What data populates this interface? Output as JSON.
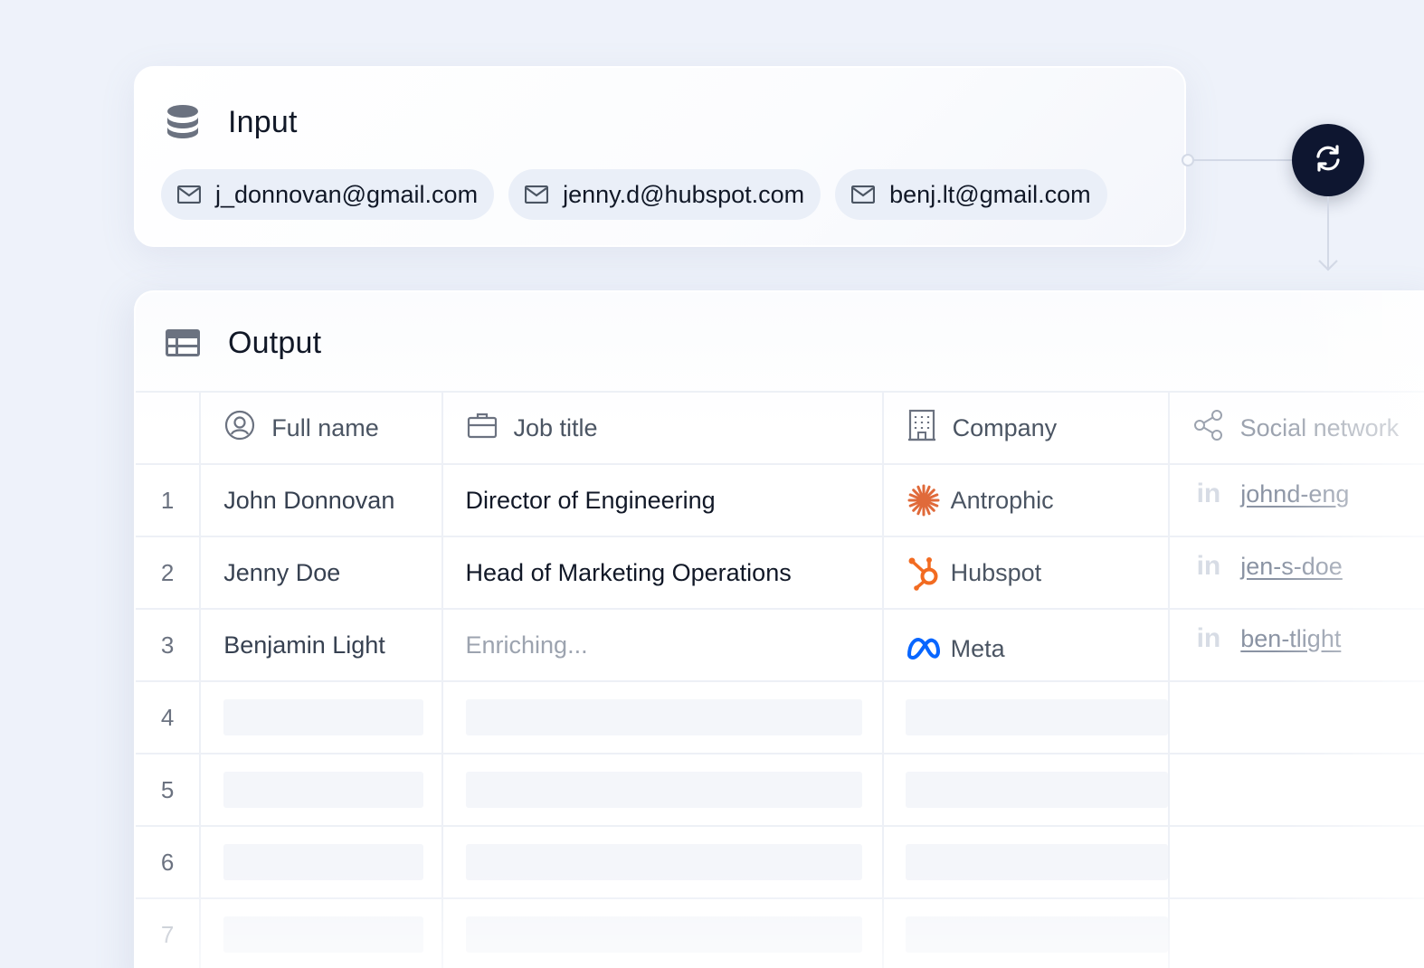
{
  "input": {
    "title": "Input",
    "header_icon": "database-icon",
    "emails": [
      {
        "icon": "mail-icon",
        "value": "j_donnovan@gmail.com"
      },
      {
        "icon": "mail-icon",
        "value": "jenny.d@hubspot.com"
      },
      {
        "icon": "mail-icon",
        "value": "benj.lt@gmail.com"
      }
    ]
  },
  "sync_button": {
    "icon": "sync-icon"
  },
  "output": {
    "title": "Output",
    "header_icon": "table-icon",
    "columns": [
      {
        "label": "Full name",
        "icon": "user-circle-icon"
      },
      {
        "label": "Job title",
        "icon": "briefcase-icon"
      },
      {
        "label": "Company",
        "icon": "building-icon"
      },
      {
        "label": "Social network",
        "icon": "share-icon"
      }
    ],
    "rows": [
      {
        "index": "1",
        "name": "John Donnovan",
        "job": "Director of Engineering",
        "company": "Antrophic",
        "company_logo": "anthropic-logo",
        "social_icon": "linkedin-icon",
        "social": "johnd-eng"
      },
      {
        "index": "2",
        "name": "Jenny Doe",
        "job": "Head of Marketing Operations",
        "company": "Hubspot",
        "company_logo": "hubspot-logo",
        "social_icon": "linkedin-icon",
        "social": "jen-s-doe"
      },
      {
        "index": "3",
        "name": "Benjamin Light",
        "job": "Enriching...",
        "company": "Meta",
        "company_logo": "meta-logo",
        "social_icon": "linkedin-icon",
        "social": "ben-tlight"
      },
      {
        "index": "4"
      },
      {
        "index": "5"
      },
      {
        "index": "6"
      },
      {
        "index": "7"
      }
    ],
    "linkedin_glyph": "in"
  },
  "colors": {
    "background": "#eef2fa",
    "sync_button": "#0e1630",
    "anthropic": "#e06a3a",
    "hubspot": "#f26b21",
    "meta": "#0866ff"
  }
}
